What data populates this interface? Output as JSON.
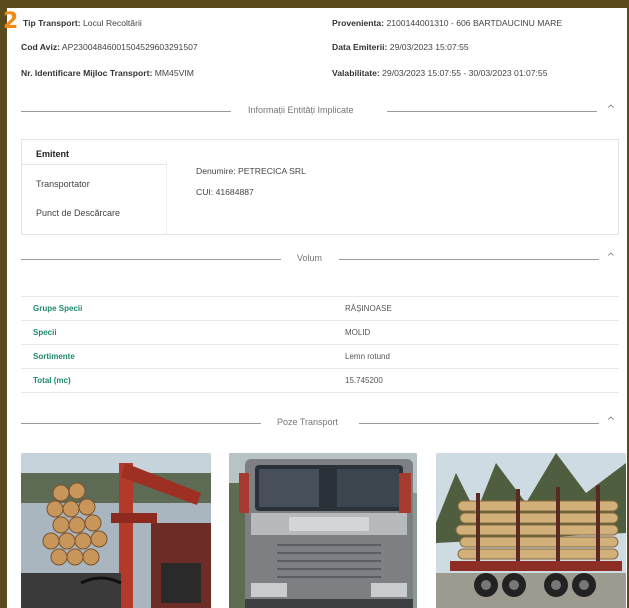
{
  "badge": "2",
  "header": {
    "tip_transport_label": "Tip Transport:",
    "tip_transport_value": "Locul Recoltării",
    "cod_aviz_label": "Cod Aviz:",
    "cod_aviz_value": "AP2300484600150452960329150‍7",
    "nr_id_label": "Nr. Identificare Mijloc Transport:",
    "nr_id_value": "MM45VIM",
    "provenienta_label": "Provenienta:",
    "provenienta_value": "2100144001310 - 606 BARTDAUCINU MARE",
    "data_emiterii_label": "Data Emiterii:",
    "data_emiterii_value": "29/03/2023 15:07:55",
    "valabilitate_label": "Valabilitate:",
    "valabilitate_value": "29/03/2023 15:07:55 - 30/03/2023 01:07:55"
  },
  "sections": {
    "entitati": "Informații Entități Implicate",
    "volum": "Volum",
    "poze": "Poze Transport"
  },
  "icons": {
    "collapse": "chevron-up-icon"
  },
  "entities": {
    "tabs": [
      "Emitent",
      "Transportator",
      "Punct de Descărcare"
    ],
    "active_tab": "Emitent",
    "denumire_label": "Denumire:",
    "denumire_value": "PETRECICA SRL",
    "cui_label": "CUI:",
    "cui_value": "41684887"
  },
  "volum": {
    "rows": [
      {
        "label": "Grupe Specii",
        "value": "RĂȘINOASE"
      },
      {
        "label": "Specii",
        "value": "MOLID"
      },
      {
        "label": "Sortimente",
        "value": "Lemn rotund"
      },
      {
        "label": "Total (mc)",
        "value": "15.745200"
      }
    ]
  },
  "colors": {
    "accent_green": "#1d8a6d",
    "badge_orange": "#f08a16",
    "frame_brown": "#5a4a1c"
  },
  "photos": [
    {
      "subject": "loaded-logging-truck-crane-photo"
    },
    {
      "subject": "scania-truck-front-photo"
    },
    {
      "subject": "log-trailer-side-photo"
    }
  ]
}
